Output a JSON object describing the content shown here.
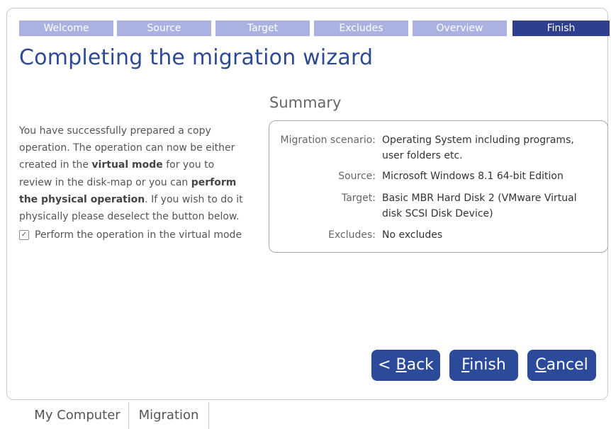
{
  "wizard": {
    "steps": [
      {
        "label": "Welcome",
        "active": false
      },
      {
        "label": "Source",
        "active": false
      },
      {
        "label": "Target",
        "active": false
      },
      {
        "label": "Excludes",
        "active": false
      },
      {
        "label": "Overview",
        "active": false
      },
      {
        "label": "Finish",
        "active": true
      }
    ],
    "title": "Completing the migration wizard"
  },
  "intro": {
    "t1": "You have successfully prepared a copy operation. The operation can now be either created in the ",
    "b1": "virtual mode",
    "t2": " for you to review in the disk-map or you can ",
    "b2": "perform the physical operation",
    "t3": ". If you wish to do it physically please deselect the button below."
  },
  "virtual_mode": {
    "label": "Perform the operation in the virtual mode",
    "checked": true,
    "check_glyph": "✓"
  },
  "summary": {
    "title": "Summary",
    "rows": [
      {
        "key": "Migration scenario:",
        "value": "Operating System including programs, user folders etc."
      },
      {
        "key": "Source:",
        "value": "Microsoft Windows 8.1 64-bit Edition"
      },
      {
        "key": "Target:",
        "value": "Basic MBR Hard Disk 2 (VMware Virtual disk SCSI Disk Device)"
      },
      {
        "key": "Excludes:",
        "value": "No excludes"
      }
    ]
  },
  "buttons": {
    "back_prefix": "< ",
    "back_mnemonic": "B",
    "back_rest": "ack",
    "finish_mnemonic": "F",
    "finish_rest": "inish",
    "cancel_mnemonic": "C",
    "cancel_rest": "ancel"
  },
  "bottom_tabs": [
    {
      "label": "My Computer",
      "active": false
    },
    {
      "label": "Migration",
      "active": true
    }
  ],
  "colors": {
    "accent": "#2c4a9a",
    "step_inactive": "#a9b2e0",
    "step_active": "#2e3f8f"
  }
}
